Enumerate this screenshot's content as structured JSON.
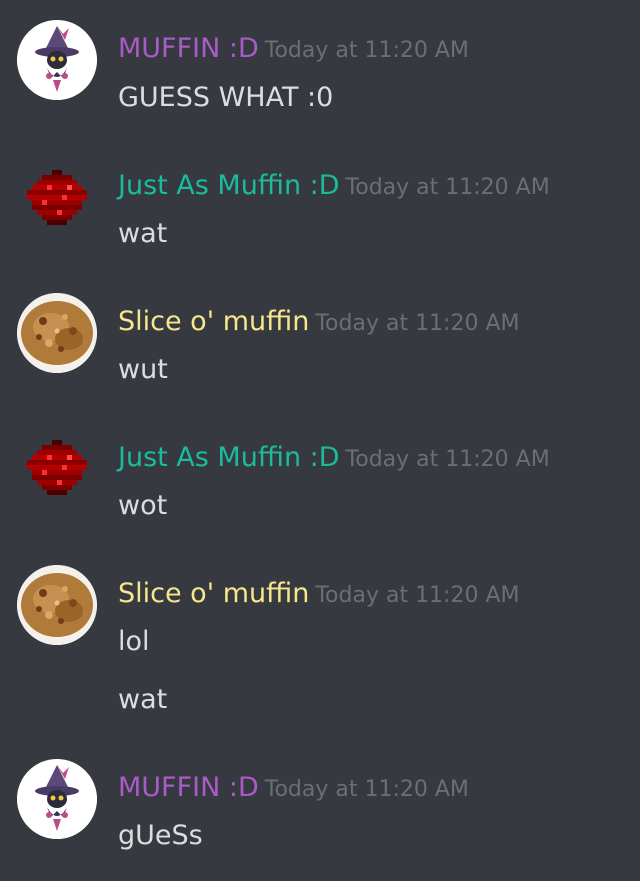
{
  "colors": {
    "background": "#36393f",
    "muffin_author": "#a95bc6",
    "just_as_muffin_author": "#1abc9c",
    "slice_author": "#f8e68a",
    "timestamp": "#6b6f75",
    "text": "#dcddde"
  },
  "messages": [
    {
      "author": "MUFFIN :D",
      "timestamp": "Today at 11:20 AM",
      "avatar_icon": "witch-pokemon-avatar-icon",
      "lines": [
        "GUESS WHAT :0"
      ]
    },
    {
      "author": "Just As Muffin :D",
      "timestamp": "Today at 11:20 AM",
      "avatar_icon": "redstone-dust-avatar-icon",
      "lines": [
        "wat"
      ]
    },
    {
      "author": "Slice o' muffin",
      "timestamp": "Today at 11:20 AM",
      "avatar_icon": "muffin-photo-avatar-icon",
      "lines": [
        "wut"
      ]
    },
    {
      "author": "Just As Muffin :D",
      "timestamp": "Today at 11:20 AM",
      "avatar_icon": "redstone-dust-avatar-icon",
      "lines": [
        "wot"
      ]
    },
    {
      "author": "Slice o' muffin",
      "timestamp": "Today at 11:20 AM",
      "avatar_icon": "muffin-photo-avatar-icon",
      "lines": [
        "lol",
        "wat"
      ]
    },
    {
      "author": "MUFFIN :D",
      "timestamp": "Today at 11:20 AM",
      "avatar_icon": "witch-pokemon-avatar-icon",
      "lines": [
        "gUeSs"
      ]
    }
  ]
}
